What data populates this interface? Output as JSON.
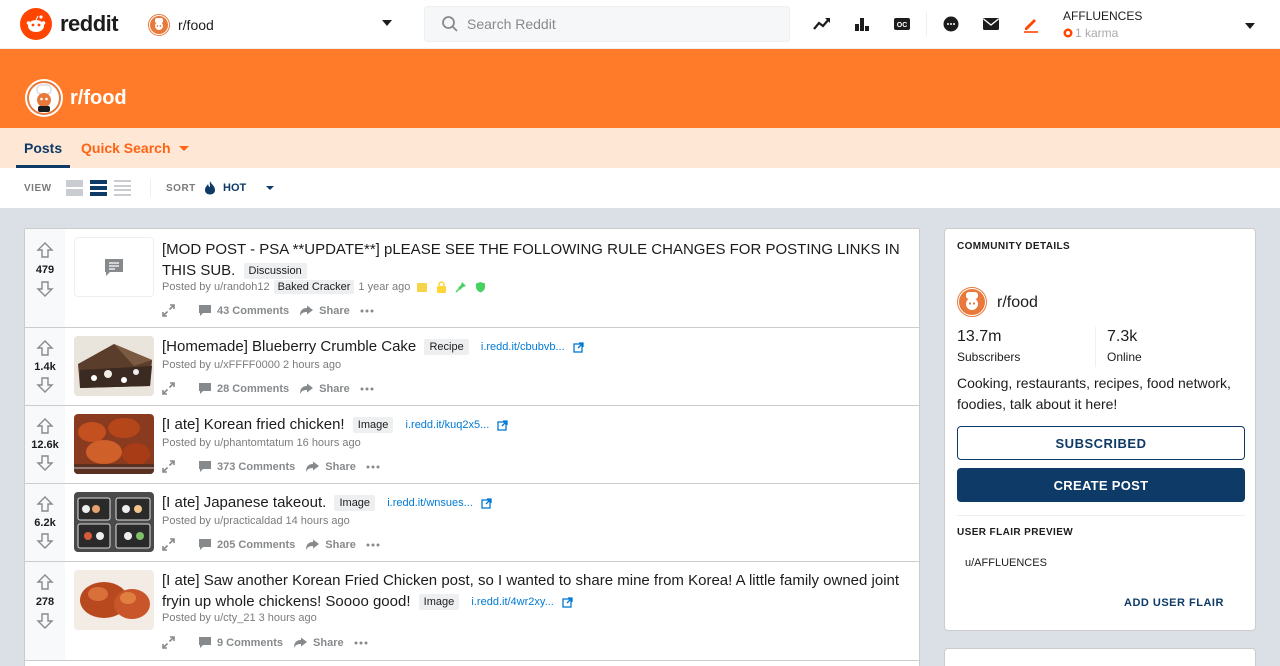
{
  "header": {
    "logo_text": "reddit",
    "community": "r/food",
    "search_placeholder": "Search Reddit",
    "user": {
      "name": "AFFLUENCES",
      "karma": "1 karma"
    }
  },
  "banner": {
    "title": "r/food"
  },
  "tabs": {
    "posts": "Posts",
    "quick_search": "Quick Search"
  },
  "viewbar": {
    "view_label": "VIEW",
    "sort_label": "SORT",
    "sort_value": "HOT"
  },
  "posts": [
    {
      "score": "479",
      "title": "[MOD POST - PSA **UPDATE**] pLEASE SEE THE FOLLOWING RULE CHANGES FOR POSTING LINKS IN THIS SUB.",
      "flair": "Discussion",
      "meta_prefix": "Posted by u/randoh12",
      "user_flair": "Baked Cracker",
      "time": "1 year ago",
      "comments": "43 Comments",
      "share": "Share",
      "link": ""
    },
    {
      "score": "1.4k",
      "title": "[Homemade] Blueberry Crumble Cake",
      "flair": "Recipe",
      "link": "i.redd.it/cbubvb...",
      "meta": "Posted by u/xFFFF0000 2 hours ago",
      "comments": "28 Comments",
      "share": "Share"
    },
    {
      "score": "12.6k",
      "title": "[I ate] Korean fried chicken!",
      "flair": "Image",
      "link": "i.redd.it/kuq2x5...",
      "meta": "Posted by u/phantomtatum 16 hours ago",
      "comments": "373 Comments",
      "share": "Share"
    },
    {
      "score": "6.2k",
      "title": "[I ate] Japanese takeout.",
      "flair": "Image",
      "link": "i.redd.it/wnsues...",
      "meta": "Posted by u/practicaldad 14 hours ago",
      "comments": "205 Comments",
      "share": "Share"
    },
    {
      "score": "278",
      "title": "[I ate] Saw another Korean Fried Chicken post, so I wanted to share mine from Korea! A little family owned joint fryin up whole chickens! Soooo good!",
      "flair": "Image",
      "link": "i.redd.it/4wr2xy...",
      "meta": "Posted by u/cty_21 3 hours ago",
      "comments": "9 Comments",
      "share": "Share"
    }
  ],
  "sidebar": {
    "heading": "COMMUNITY DETAILS",
    "name": "r/food",
    "subscribers_value": "13.7m",
    "subscribers_label": "Subscribers",
    "online_value": "7.3k",
    "online_label": "Online",
    "description": "Cooking, restaurants, recipes, food network, foodies, talk about it here!",
    "subscribed_button": "SUBSCRIBED",
    "create_button": "CREATE POST",
    "flair_heading": "USER FLAIR PREVIEW",
    "flair_user": "u/AFFLUENCES",
    "add_flair": "ADD USER FLAIR"
  },
  "colors": {
    "brand": "#ff4500",
    "banner": "#ff7b29",
    "navy": "#0e3a67",
    "tabs_bg": "#ffe7d6"
  }
}
